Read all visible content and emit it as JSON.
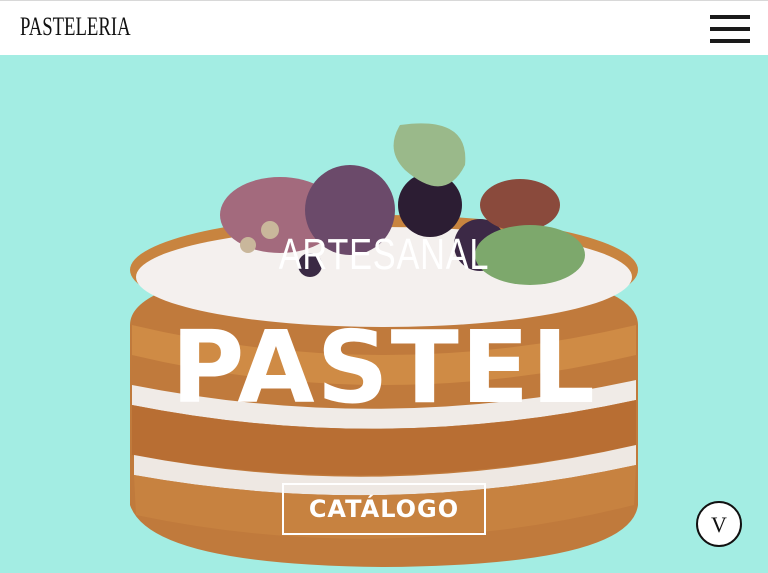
{
  "header": {
    "logo": "PASTELERIA",
    "menu_icon": "hamburger-icon"
  },
  "hero": {
    "kicker": "ARTESANAL",
    "title": "PASTEL",
    "cta_label": "CATÁLOGO",
    "scroll_label": "V",
    "background_color": "#a3ede3",
    "image": "layered naked cake with figs, grapes and eucalyptus leaves"
  }
}
